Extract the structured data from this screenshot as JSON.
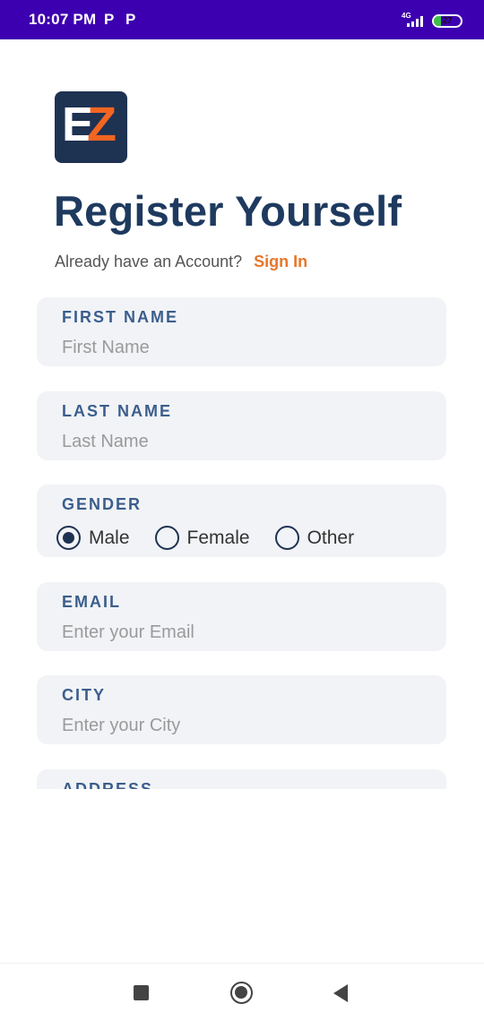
{
  "status_bar": {
    "time": "10:07 PM",
    "notif_1": "P",
    "notif_2": "P",
    "network_label": "4G",
    "battery_percent": "27",
    "battery_level": 0.27
  },
  "logo": {
    "letter_1": "E",
    "letter_2": "Z",
    "color_1": "#ffffff",
    "color_2": "#f26522",
    "background": "#1e3252"
  },
  "title": "Register Yourself",
  "signin": {
    "prompt": "Already have an Account?",
    "link": "Sign In"
  },
  "form": {
    "first_name": {
      "label": "FIRST NAME",
      "placeholder": "First Name",
      "value": ""
    },
    "last_name": {
      "label": "LAST NAME",
      "placeholder": "Last Name",
      "value": ""
    },
    "gender": {
      "label": "GENDER",
      "options": [
        "Male",
        "Female",
        "Other"
      ],
      "selected": "Male"
    },
    "email": {
      "label": "EMAIL",
      "placeholder": "Enter your Email",
      "value": ""
    },
    "city": {
      "label": "CITY",
      "placeholder": "Enter your City",
      "value": ""
    },
    "address": {
      "label": "ADDRESS"
    }
  },
  "nav": {
    "recents": "recents-icon",
    "home": "home-icon",
    "back": "back-icon"
  },
  "colors": {
    "accent": "#e8762b",
    "primary": "#1e3a5f",
    "status_bar": "#3d00b0",
    "field_bg": "#f1f3f6",
    "label": "#3b5e8c"
  }
}
